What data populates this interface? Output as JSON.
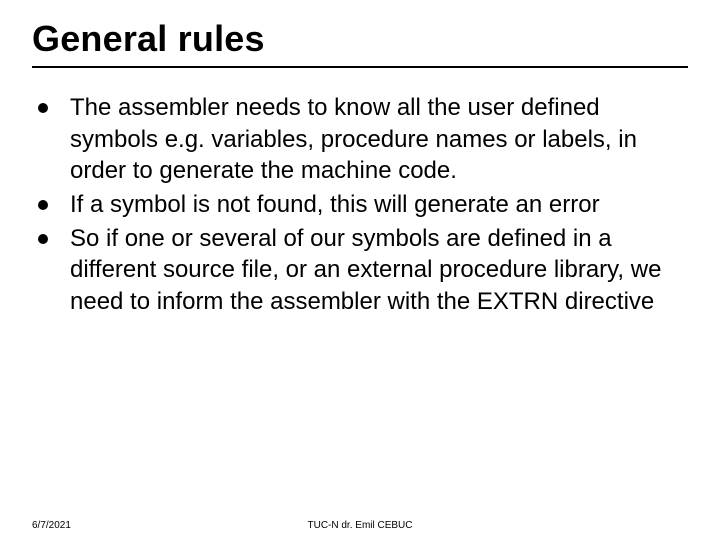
{
  "title": "General rules",
  "bullets": [
    "The assembler needs to know all the user defined symbols e.g. variables, procedure names or labels, in order to generate the machine code.",
    "If a symbol is not found, this will generate an error",
    "So if one or several of our symbols are defined in a different source file, or an external procedure library, we need to inform the assembler with the EXTRN directive"
  ],
  "footer": {
    "date": "6/7/2021",
    "attribution": "TUC-N dr. Emil CEBUC"
  }
}
